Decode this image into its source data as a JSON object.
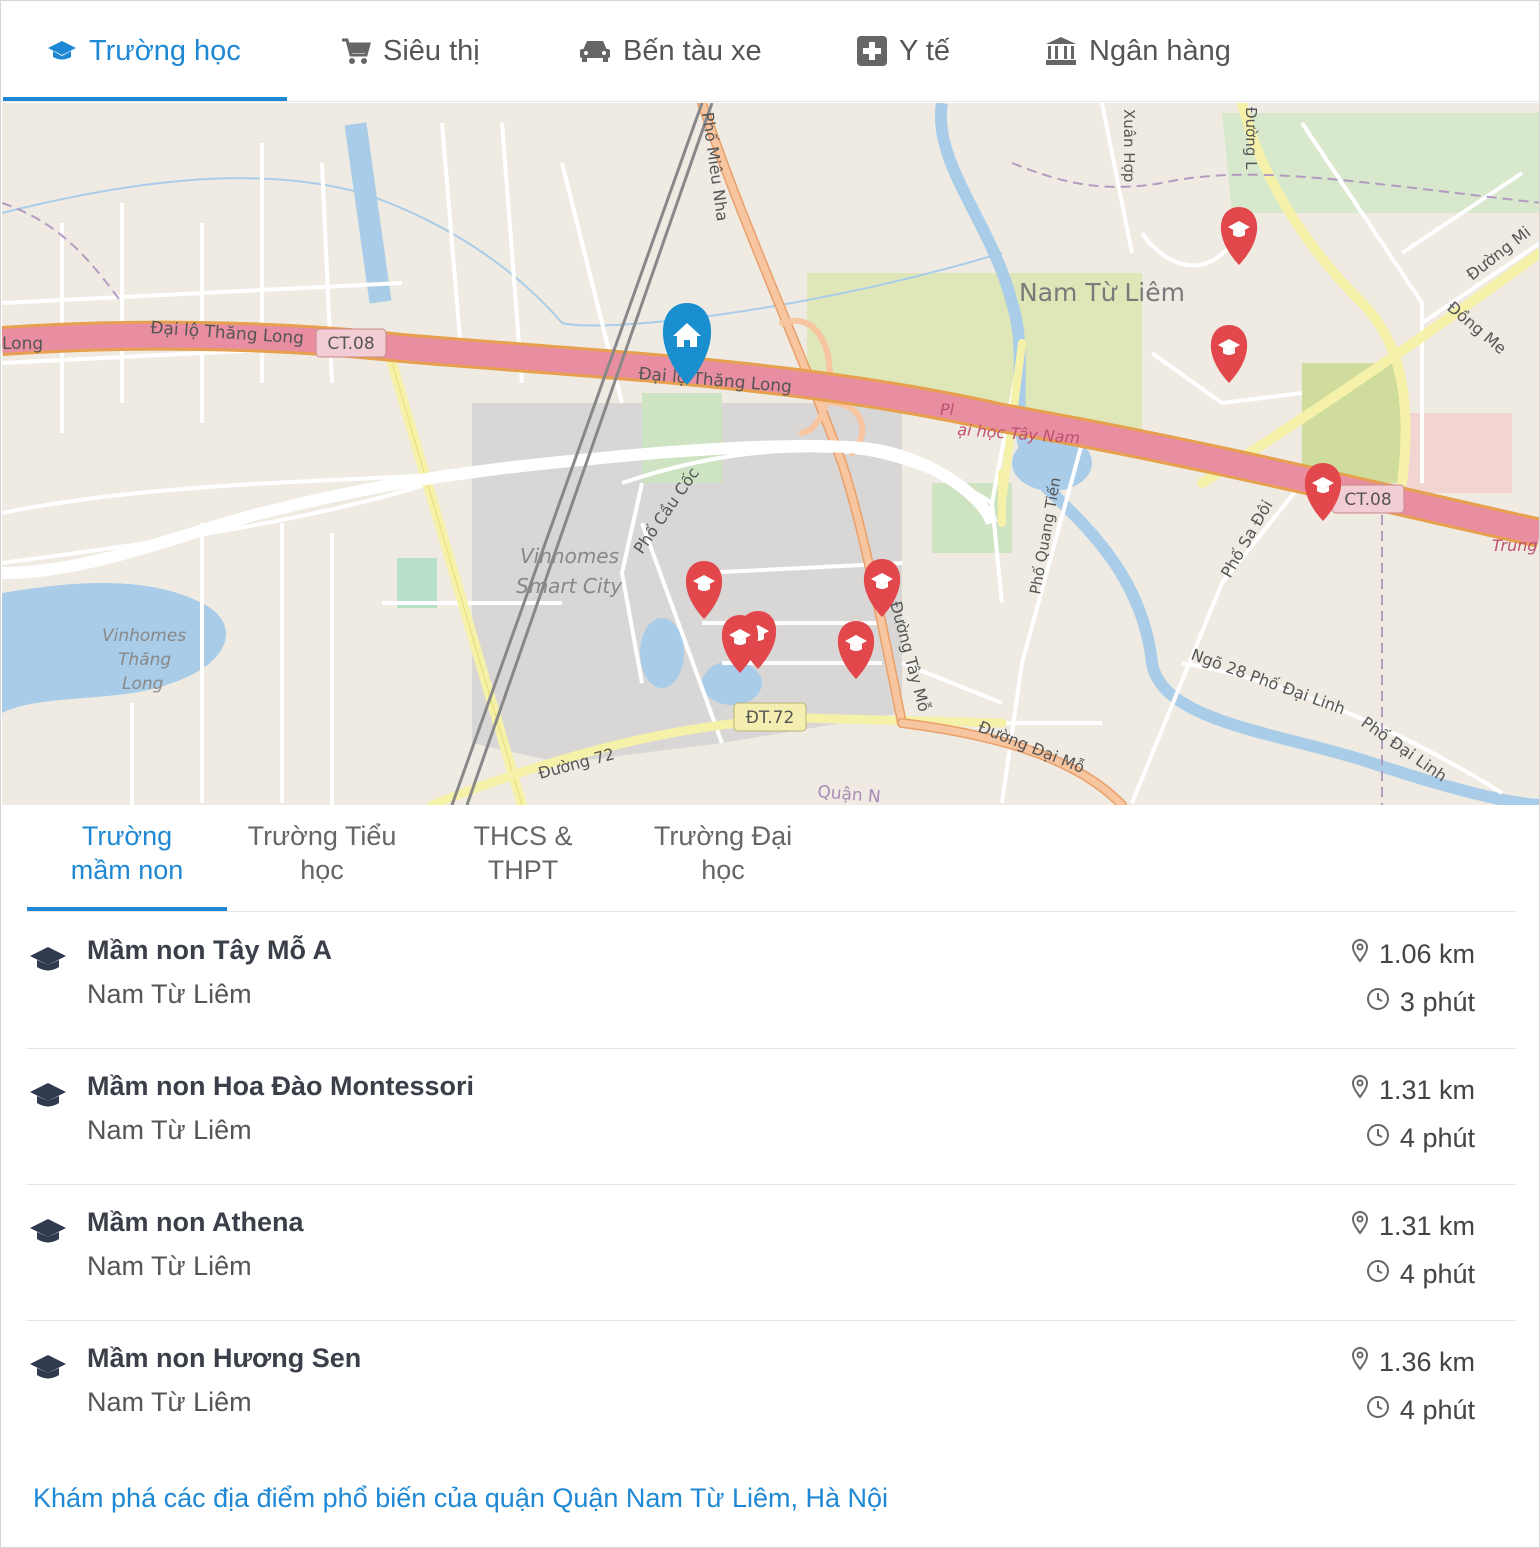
{
  "top_tabs": [
    {
      "label": "Trường học",
      "icon": "graduation-cap-icon",
      "active": true
    },
    {
      "label": "Siêu thị",
      "icon": "cart-icon"
    },
    {
      "label": "Bến tàu xe",
      "icon": "car-icon"
    },
    {
      "label": "Y tế",
      "icon": "medical-plus-icon"
    },
    {
      "label": "Ngân hàng",
      "icon": "bank-icon"
    }
  ],
  "map": {
    "labels": {
      "dai_lo_thang_long_w": "Đại lộ Thăng Long",
      "long": "Long",
      "ct08_a": "CT.08",
      "dai_lo_thang_long_c": "Đại lộ Thăng Long",
      "ct08_b": "CT.08",
      "trung": "Trung",
      "pho_mieu_nha": "Phố Miêu Nha",
      "nam_tu_liem": "Nam Từ Liêm",
      "dai_hoc_tay_nam": "ại học Tây Nam",
      "pl": "Pl",
      "vinhomes_smart_1": "Vinhomes",
      "vinhomes_smart_2": "Smart City",
      "vinhomes_tl_1": "Vinhomes",
      "vinhomes_tl_2": "Thăng",
      "vinhomes_tl_3": "Long",
      "pho_cau_coc": "Phố Cầu Cốc",
      "pho_quang_tien": "Phố Quang Tiến",
      "pho_sa_doi": "Phố Sa Đôi",
      "ngo_28": "Ngõ 28 Phố Đại Linh",
      "pho_dai_linh": "Phố Đại Linh",
      "dt72": "ĐT.72",
      "duong_72": "Đường 72",
      "duong_dai_mo": "Đường Đại Mỗ",
      "duong_tay_mo": "Đường Tây Mỗ",
      "quan_n": "Quận N",
      "xuan_hop": "Xuân Hợp",
      "dong_me": "Đồng Me",
      "duong_mi": "Đường Mi",
      "duong_l": "Đường L"
    }
  },
  "sub_tabs": [
    {
      "line1": "Trường",
      "line2": "mầm non",
      "active": true
    },
    {
      "line1": "Trường Tiểu",
      "line2": "học"
    },
    {
      "line1": "THCS &",
      "line2": "THPT"
    },
    {
      "line1": "Trường Đại",
      "line2": "học"
    }
  ],
  "schools": [
    {
      "name": "Mầm non Tây Mỗ A",
      "district": "Nam Từ Liêm",
      "distance": "1.06 km",
      "time": "3 phút"
    },
    {
      "name": "Mầm non Hoa Đào Montessori",
      "district": "Nam Từ Liêm",
      "distance": "1.31 km",
      "time": "4 phút"
    },
    {
      "name": "Mầm non Athena",
      "district": "Nam Từ Liêm",
      "distance": "1.31 km",
      "time": "4 phút"
    },
    {
      "name": "Mầm non Hương Sen",
      "district": "Nam Từ Liêm",
      "distance": "1.36 km",
      "time": "4 phút"
    }
  ],
  "explore_link": "Khám phá các địa điểm phổ biến của quận Quận Nam Từ Liêm, Hà Nội",
  "colors": {
    "accent": "#1e88d4",
    "marker": "#e2474c",
    "highway": "#e88ea0",
    "home_marker": "#1a8fd0"
  }
}
